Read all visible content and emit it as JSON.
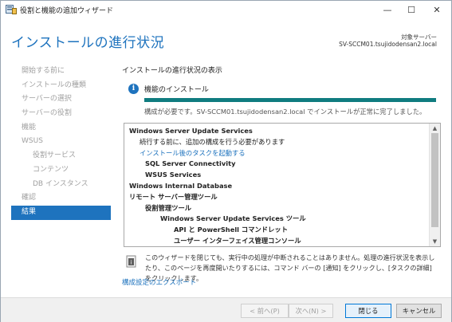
{
  "window": {
    "title": "役割と機能の追加ウィザード",
    "controls": {
      "minimize": "—",
      "maximize": "☐",
      "close": "✕"
    }
  },
  "header": {
    "page_title": "インストールの進行状況",
    "target_server_label": "対象サーバー",
    "target_server_value": "SV-SCCM01.tsujidodensan2.local"
  },
  "nav": {
    "items": [
      {
        "label": "開始する前に"
      },
      {
        "label": "インストールの種類"
      },
      {
        "label": "サーバーの選択"
      },
      {
        "label": "サーバーの役割"
      },
      {
        "label": "機能"
      },
      {
        "label": "WSUS"
      },
      {
        "label": "役割サービス"
      },
      {
        "label": "コンテンツ"
      },
      {
        "label": "DB インスタンス"
      },
      {
        "label": "確認"
      },
      {
        "label": "結果"
      }
    ],
    "active_index": 10
  },
  "main": {
    "section_heading": "インストールの進行状況の表示",
    "feature_label": "機能のインストール",
    "progress": 1.0,
    "status_text": "構成が必要です。SV-SCCM01.tsujidodensan2.local でインストールが正常に完了しました。",
    "results": {
      "wsus_title": "Windows Server Update Services",
      "wsus_note": "続行する前に、追加の構成を行う必要があります",
      "post_install_link": "インストール後のタスクを起動する",
      "sql_conn": "SQL Server Connectivity",
      "wsus_services": "WSUS Services",
      "wid": "Windows Internal Database",
      "rsat": "リモート サーバー管理ツール",
      "role_tools": "役割管理ツール",
      "wsus_tools": "Windows Server Update Services ツール",
      "api_ps": "API と PowerShell コマンドレット",
      "ui_console": "ユーザー インターフェイス管理コンソール"
    },
    "note_text": "このウィザードを閉じても、実行中の処理が中断されることはありません。処理の進行状況を表示したり、このページを再度開いたりするには、コマンド バーの [通知] をクリックし、[タスクの詳細] をクリックします。",
    "export_link": "構成設定のエクスポート"
  },
  "footer": {
    "prev_label": "< 前へ(P)",
    "next_label": "次へ(N) >",
    "close_label": "閉じる",
    "cancel_label": "キャンセル"
  },
  "colors": {
    "accent": "#1e73be",
    "progress": "#107c80"
  }
}
